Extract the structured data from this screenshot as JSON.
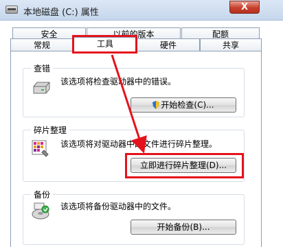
{
  "window": {
    "title": "本地磁盘 (C:) 属性",
    "close_label": "X",
    "close_color": "#c7402c"
  },
  "tabs": {
    "row1": [
      "安全",
      "以前的版本",
      "配额"
    ],
    "row2": [
      "常规",
      "工具",
      "硬件",
      "共享"
    ],
    "active": "工具"
  },
  "sections": {
    "check": {
      "title": "查错",
      "description": "该选项将检查驱动器中的错误。",
      "button_label": "开始检查(C)...",
      "icon": "drive-icon"
    },
    "defrag": {
      "title": "碎片整理",
      "description": "该选项将对驱动器中的文件进行碎片整理。",
      "button_label": "立即进行碎片整理(D)...",
      "icon": "defrag-icon"
    },
    "backup": {
      "title": "备份",
      "description": "该选项将备份驱动器中的文件。",
      "button_label": "开始备份(B)...",
      "icon": "backup-icon"
    }
  },
  "annotation": {
    "highlight_color": "#e4121c"
  }
}
